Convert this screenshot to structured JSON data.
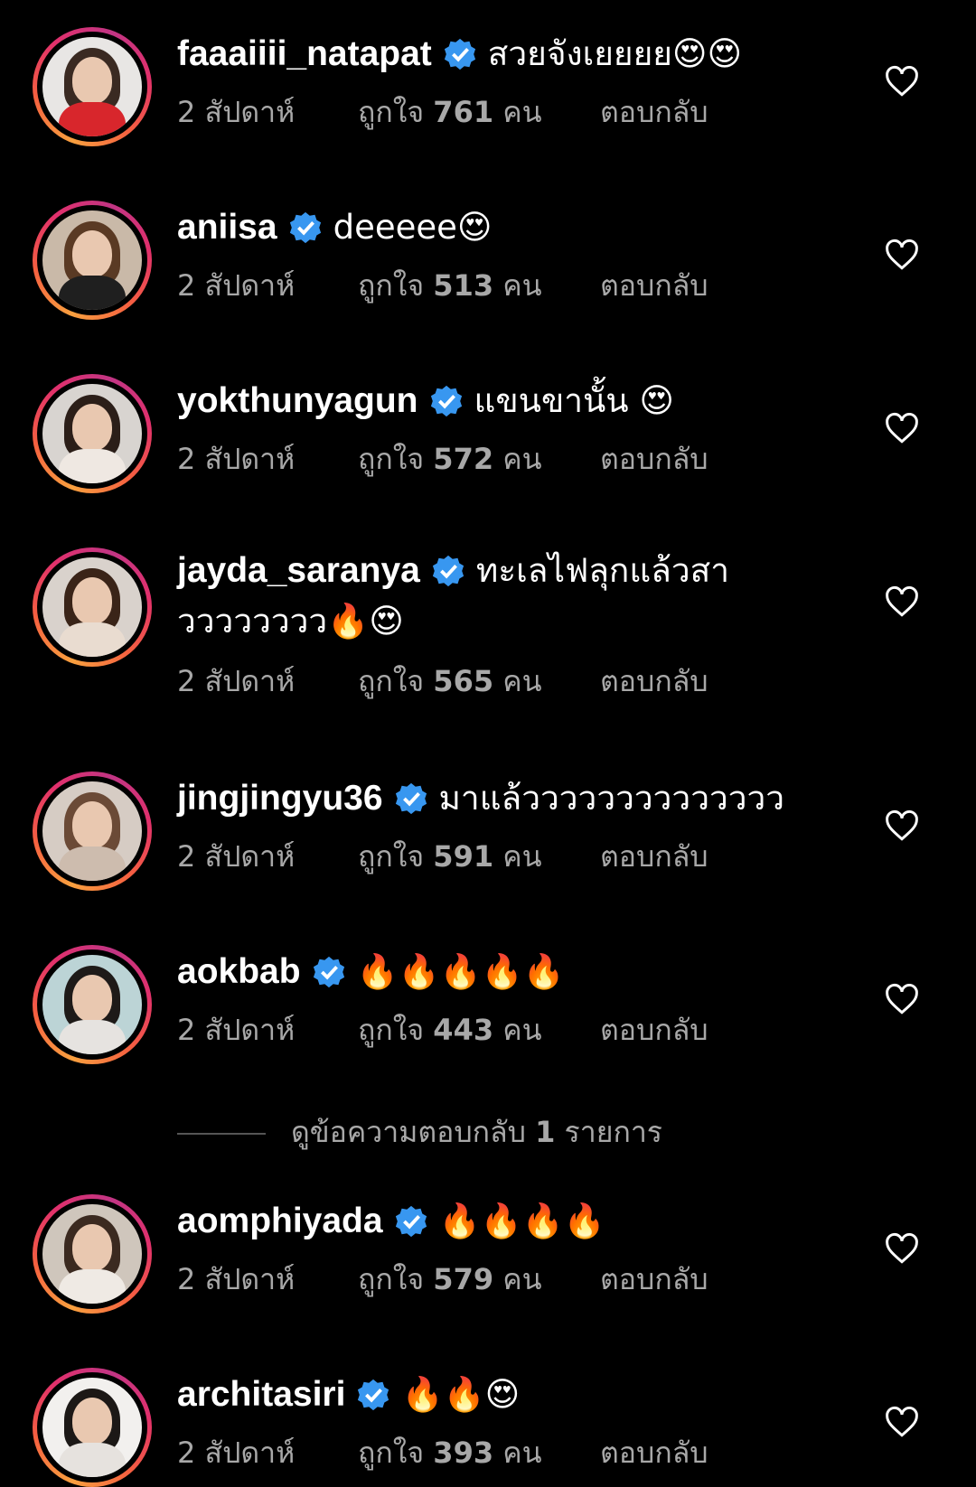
{
  "comments": [
    {
      "username": "faaaiiii_natapat",
      "text": "สวยจังเยยยย😍😍",
      "time": "2 สัปดาห์",
      "likes_prefix": "ถูกใจ",
      "likes_count": "761",
      "likes_suffix": "คน",
      "reply": "ตอบกลับ"
    },
    {
      "username": "aniisa",
      "text": "deeeee😍",
      "time": "2 สัปดาห์",
      "likes_prefix": "ถูกใจ",
      "likes_count": "513",
      "likes_suffix": "คน",
      "reply": "ตอบกลับ"
    },
    {
      "username": "yokthunyagun",
      "text": "แขนขานั้น 😍",
      "time": "2 สัปดาห์",
      "likes_prefix": "ถูกใจ",
      "likes_count": "572",
      "likes_suffix": "คน",
      "reply": "ตอบกลับ"
    },
    {
      "username": "jayda_saranya",
      "text": "ทะเลไฟลุกแล้วสาวววววววว🔥😍",
      "time": "2 สัปดาห์",
      "likes_prefix": "ถูกใจ",
      "likes_count": "565",
      "likes_suffix": "คน",
      "reply": "ตอบกลับ"
    },
    {
      "username": "jingjingyu36",
      "text": "มาแล้วววววววววววววว",
      "time": "2 สัปดาห์",
      "likes_prefix": "ถูกใจ",
      "likes_count": "591",
      "likes_suffix": "คน",
      "reply": "ตอบกลับ"
    },
    {
      "username": "aokbab",
      "text": "🔥🔥🔥🔥🔥",
      "time": "2 สัปดาห์",
      "likes_prefix": "ถูกใจ",
      "likes_count": "443",
      "likes_suffix": "คน",
      "reply": "ตอบกลับ"
    },
    {
      "username": "aomphiyada",
      "text": "🔥🔥🔥🔥",
      "time": "2 สัปดาห์",
      "likes_prefix": "ถูกใจ",
      "likes_count": "579",
      "likes_suffix": "คน",
      "reply": "ตอบกลับ"
    },
    {
      "username": "architasiri",
      "text": "🔥🔥😍",
      "time": "2 สัปดาห์",
      "likes_prefix": "ถูกใจ",
      "likes_count": "393",
      "likes_suffix": "คน",
      "reply": "ตอบกลับ"
    }
  ],
  "view_replies": {
    "prefix": "ดูข้อความตอบกลับ",
    "count": "1",
    "suffix": "รายการ"
  },
  "colors": {
    "background": "#000000",
    "text": "#ffffff",
    "meta": "#a8a8a8",
    "verified": "#3897f0"
  }
}
